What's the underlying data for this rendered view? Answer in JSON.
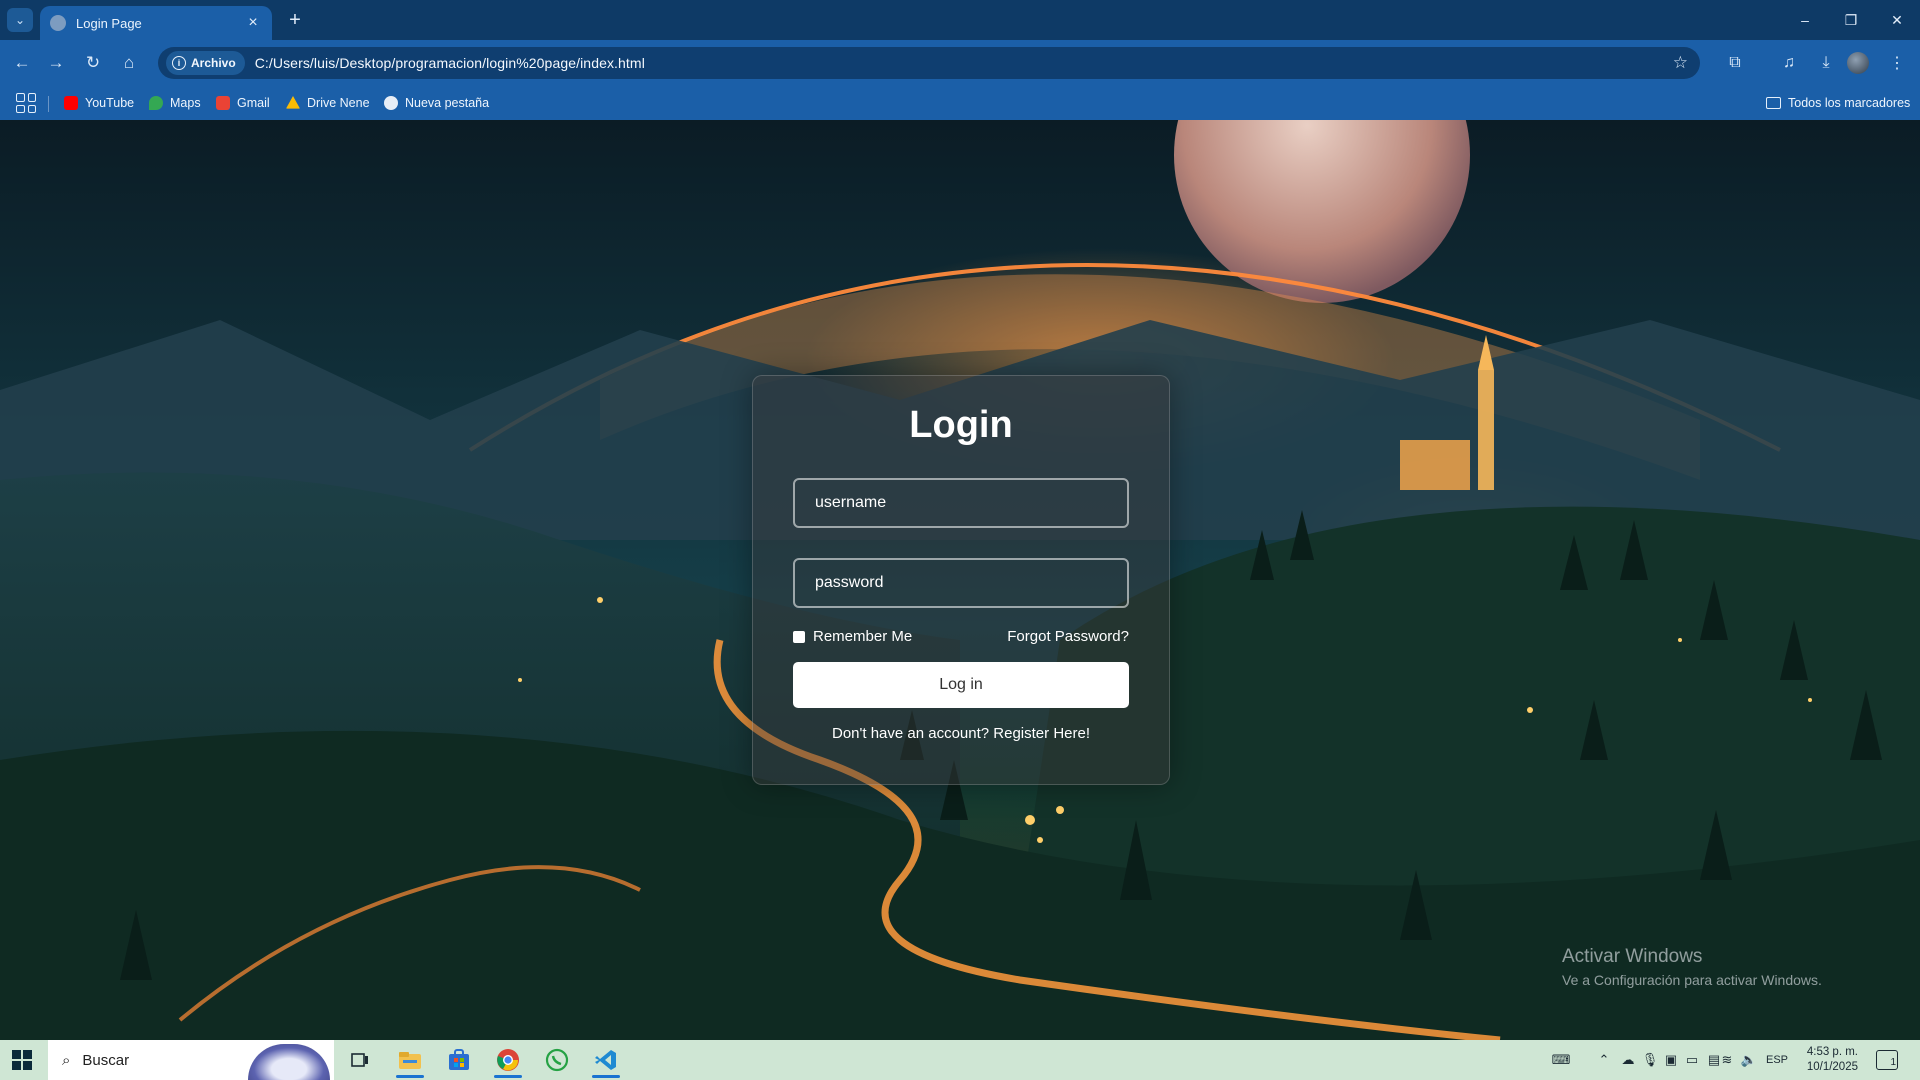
{
  "browser": {
    "tab": {
      "title": "Login Page",
      "close": "×"
    },
    "new_tab": "+",
    "window": {
      "minimize": "–",
      "restore": "❐",
      "close": "✕"
    },
    "nav": {
      "back": "←",
      "forward": "→",
      "reload": "↻",
      "home": "⌂"
    },
    "address": {
      "chip_label": "Archivo",
      "url": "C:/Users/luis/Desktop/programacion/login%20page/index.html"
    },
    "bookmarks": [
      {
        "label": "YouTube",
        "icon": "youtube-icon",
        "color": "#ff0000"
      },
      {
        "label": "Maps",
        "icon": "maps-icon",
        "color": "#34a853"
      },
      {
        "label": "Gmail",
        "icon": "gmail-icon",
        "color": "#ea4335"
      },
      {
        "label": "Drive Nene",
        "icon": "drive-icon",
        "color": "#fbbc04"
      },
      {
        "label": "Nueva pestaña",
        "icon": "globe-icon",
        "color": "#e8eef6"
      }
    ],
    "all_bookmarks": "Todos los marcadores"
  },
  "login": {
    "title": "Login",
    "username_placeholder": "username",
    "password_placeholder": "password",
    "remember_label": "Remember Me",
    "forgot_label": "Forgot Password?",
    "button_label": "Log in",
    "register_text": "Don't have an account? Register Here!"
  },
  "watermark": {
    "title": "Activar Windows",
    "subtitle": "Ve a Configuración para activar Windows."
  },
  "taskbar": {
    "search_label": "Buscar",
    "language": "ESP",
    "time": "4:53 p. m.",
    "date": "10/1/2025",
    "notification_count": "1"
  },
  "colors": {
    "chrome_dark": "#0e3a66",
    "chrome": "#1b5fa8",
    "taskbar": "#cfe6d4"
  }
}
